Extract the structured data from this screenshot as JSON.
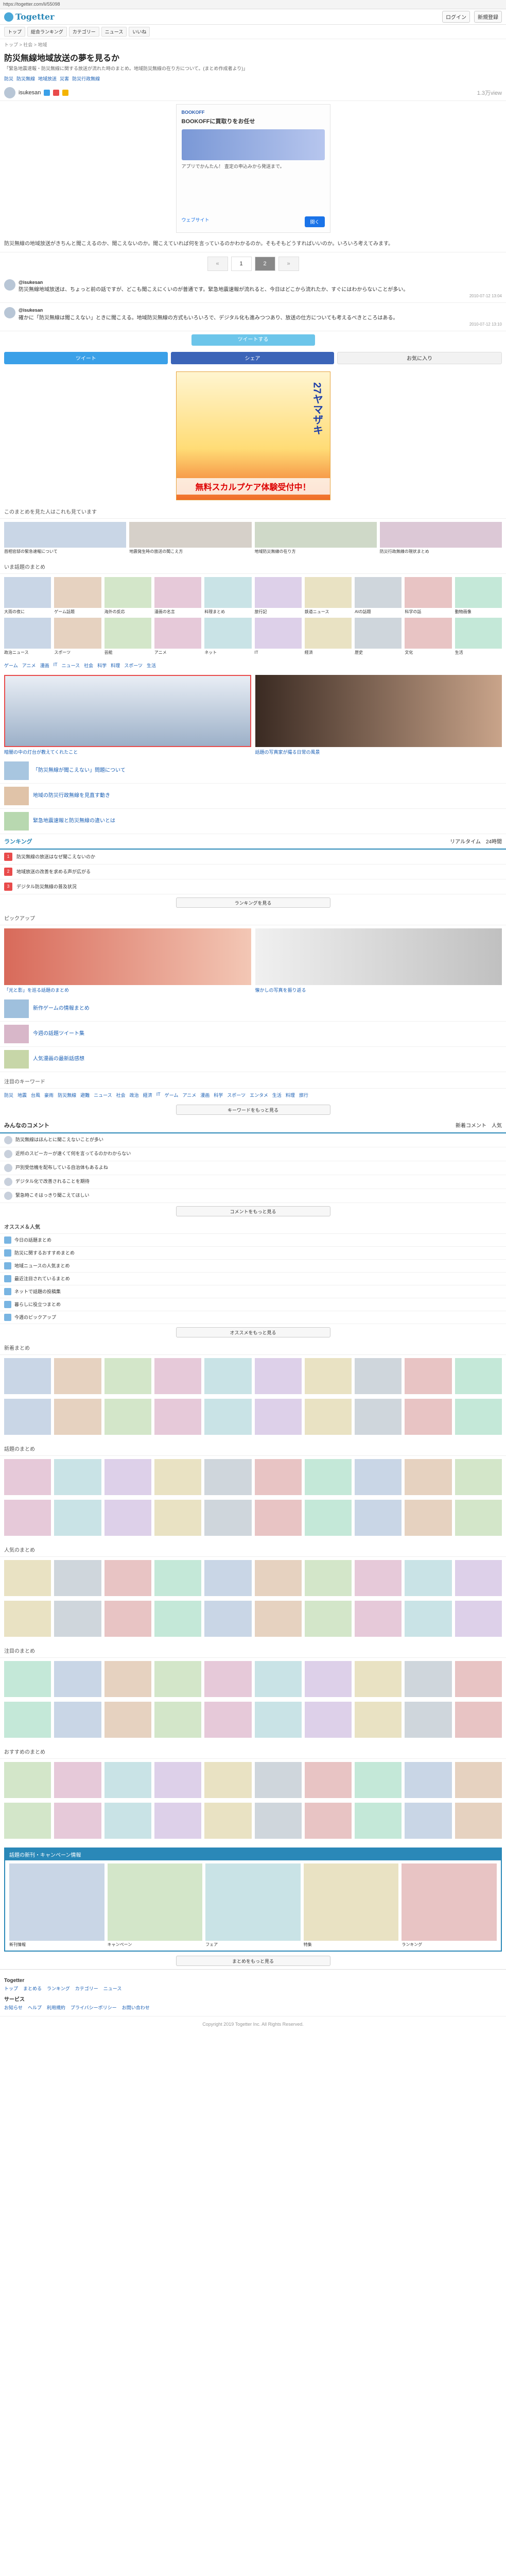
{
  "url": "https://togetter.com/li/55098",
  "brand": "Togetter",
  "top_links": [
    "ログイン",
    "新規登録"
  ],
  "nav": [
    "トップ",
    "総合ランキング",
    "カテゴリー",
    "ニュース",
    "いいね"
  ],
  "breadcrumb": "トップ > 社会 > 地域",
  "title": "防災無線地域放送の夢を見るか",
  "description": "「緊急地震速報・防災無線に関する放送が流れた時のまとめ。地域防災無線の在り方について。(まとめ作成者より)」",
  "tags": [
    "防災",
    "防災無線",
    "地域放送",
    "災害",
    "防災行政無線"
  ],
  "author": "isukesan",
  "views": "1.3万view",
  "ad": {
    "label": "BOOKOFF",
    "title": "BOOKOFFに買取りをお任せ",
    "text": "アプリでかんたん！ 査定の申込みから発送まで。",
    "cta": "開く",
    "sub": "ウェブサイト"
  },
  "summary": "防災無線の地域放送がきちんと聞こえるのか、聞こえないのか。聞こえていれば何を言っているのかわかるのか。そもそもどうすればいいのか。いろいろ考えてみます。",
  "pager": {
    "prev": "«",
    "p1": "1",
    "p2": "2",
    "next": "»"
  },
  "tweet1": {
    "user": "@isukesan",
    "body": "防災無線地域放送は、ちょっと前の話ですが、どこも聞こえにくいのが普通です。緊急地震速報が流れると、今日はどこから流れたか、すぐにはわからないことが多い。",
    "meta": "2010-07-12 13:04"
  },
  "tweet2": {
    "user": "@isukesan",
    "body": "確かに「防災無線は聞こえない」ときに聞こえる。地域防災無線の方式もいろいろで、デジタル化も進みつつあり、放送の仕方についても考えるべきところはある。",
    "meta": "2010-07-12 13:10"
  },
  "tweet_btn": "ツイートする",
  "share": {
    "tw": "ツイート",
    "fb": "シェア",
    "fav": "お気に入り"
  },
  "manga_ad": {
    "t1": "27ヤマザキ",
    "t2": "無料スカルプケア体験受付中！"
  },
  "sec_recommend": "このまとめを見た人はこれも見ています",
  "recommend_cards": [
    "首相官邸の緊急速報について",
    "地震発生時の放送の聞こえ方",
    "地域防災無線の在り方",
    "防災行政無線の現状まとめ"
  ],
  "sec_trending": "いま話題のまとめ",
  "trending": [
    "大雨の夜に",
    "ゲーム話題",
    "海外の反応",
    "漫画の名言",
    "料理まとめ",
    "旅行記",
    "鉄道ニュース",
    "AIの話題",
    "科学の話",
    "動物画像",
    "政治ニュース",
    "スポーツ",
    "芸能",
    "アニメ",
    "ネット",
    "IT",
    "経済",
    "歴史",
    "文化",
    "生活"
  ],
  "keywords_row": [
    "ゲーム",
    "アニメ",
    "漫画",
    "IT",
    "ニュース",
    "社会",
    "科学",
    "料理",
    "スポーツ",
    "生活"
  ],
  "feature": {
    "left": "暗闇の中の灯台が教えてくれたこと",
    "right": "話題の写真家が撮る日常の風景"
  },
  "feature_list": [
    "「防災無線が聞こえない」問題について",
    "地域の防災行政無線を見直す動き",
    "緊急地震速報と防災無線の違いとは"
  ],
  "ranking": {
    "title": "ランキング",
    "tabs": [
      "リアルタイム",
      "24時間"
    ],
    "rows": [
      "防災無線の放送はなぜ聞こえないのか",
      "地域放送の改善を求める声が広がる",
      "デジタル防災無線の普及状況"
    ],
    "more": "ランキングを見る"
  },
  "sec_pickup": "ピックアップ",
  "pickup": {
    "left": "「光と影」を巡る話題のまとめ",
    "right": "懐かしの写真を振り返る"
  },
  "pickup_list": [
    "新作ゲームの情報まとめ",
    "今週の話題ツイート集",
    "人気漫画の最新話感想"
  ],
  "sec_keywords": "注目のキーワード",
  "keywords": [
    "防災",
    "地震",
    "台風",
    "豪雨",
    "防災無線",
    "避難",
    "ニュース",
    "社会",
    "政治",
    "経済",
    "IT",
    "ゲーム",
    "アニメ",
    "漫画",
    "科学",
    "スポーツ",
    "エンタメ",
    "生活",
    "料理",
    "旅行"
  ],
  "keywords_more": "キーワードをもっと見る",
  "sec_comments": "みんなのコメント",
  "comments_tabs": [
    "新着コメント",
    "人気"
  ],
  "comments": [
    "防災無線はほんとに聞こえないことが多い",
    "近所のスピーカーが遠くて何を言ってるのかわからない",
    "戸別受信機を配布している自治体もあるよね",
    "デジタル化で改善されることを期待",
    "緊急時こそはっきり聞こえてほしい"
  ],
  "comments_more": "コメントをもっと見る",
  "sec_osusume": "オススメ＆人気",
  "osusume": [
    "今日の話題まとめ",
    "防災に関するおすすめまとめ",
    "地域ニュースの人気まとめ",
    "最近注目されているまとめ",
    "ネットで話題の投稿集",
    "暮らしに役立つまとめ",
    "今週のピックアップ"
  ],
  "osusume_more": "オススメをもっと見る",
  "sec_grid1": "新着まとめ",
  "sec_grid2": "話題のまとめ",
  "sec_grid3": "人気のまとめ",
  "sec_grid4": "注目のまとめ",
  "sec_grid5": "おすすめのまとめ",
  "grid_more": "まとめをもっと見る",
  "sec_banner": "話題の新刊・キャンペーン情報",
  "banner_items": [
    "新刊情報",
    "キャンペーン",
    "フェア",
    "特集",
    "ランキング"
  ],
  "footer": {
    "sections": [
      {
        "h": "Togetter",
        "links": [
          "トップ",
          "まとめる",
          "ランキング",
          "カテゴリー",
          "ニュース"
        ]
      },
      {
        "h": "サービス",
        "links": [
          "お知らせ",
          "ヘルプ",
          "利用規約",
          "プライバシーポリシー",
          "お問い合わせ"
        ]
      }
    ],
    "copyright": "Copyright 2019 Togetter Inc. All Rights Reserved."
  }
}
